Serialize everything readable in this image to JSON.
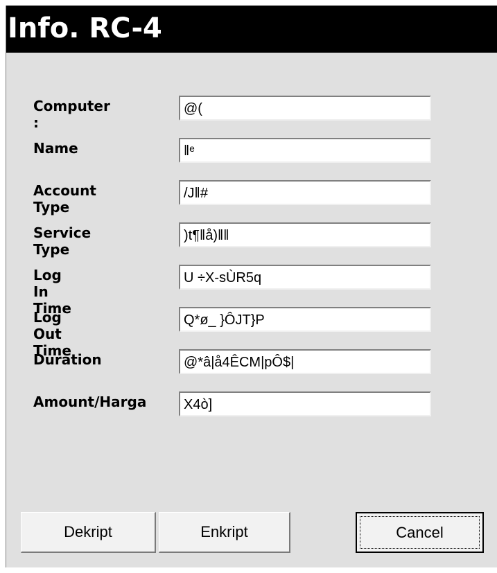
{
  "window": {
    "title": "Info. RC-4"
  },
  "form": {
    "fields": [
      {
        "label": "Computer :",
        "value": "@("
      },
      {
        "label": "Name",
        "value": "‖ᵉ"
      },
      {
        "label": "Account Type",
        "value": "/J‖#"
      },
      {
        "label": "Service Type",
        "value": ")t¶‖å)‖‖"
      },
      {
        "label": "Log In Time",
        "value": "U ÷X-sÙR5q"
      },
      {
        "label": "Log Out Time",
        "value": "Q*ø_ }ÔJT}P"
      },
      {
        "label": "Duration",
        "value": "@*â|å4ÊCM|pÔ$|"
      },
      {
        "label": "Amount/Harga",
        "value": "X4ò]"
      }
    ]
  },
  "buttons": {
    "dekript": "Dekript",
    "enkript": "Enkript",
    "cancel": "Cancel"
  }
}
